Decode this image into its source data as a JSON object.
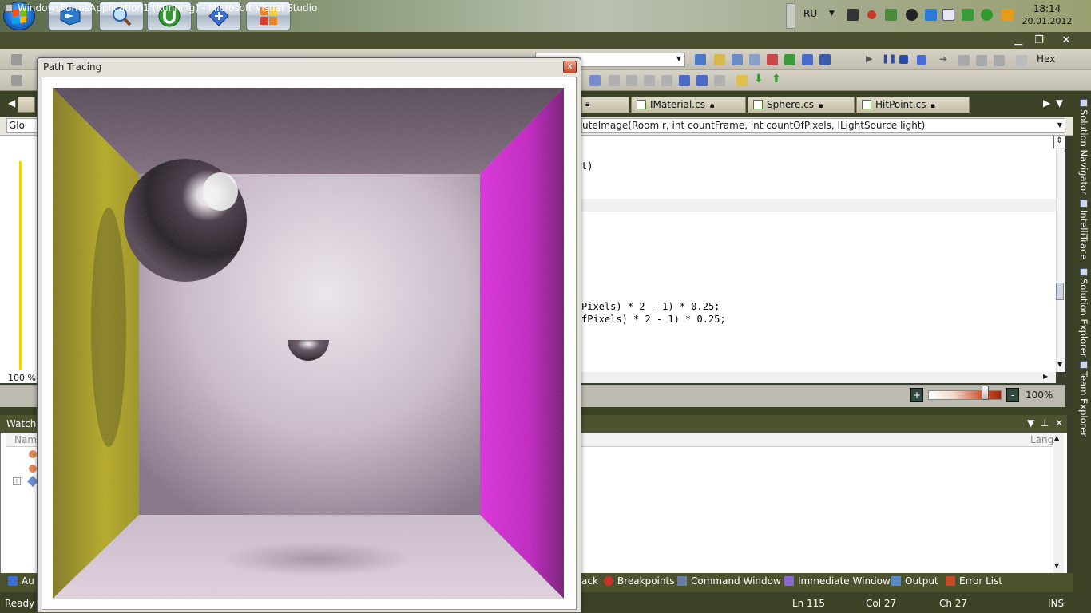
{
  "taskbar": {
    "apps": [
      {
        "name": "vs-app-button",
        "accent": "#2c78c8"
      },
      {
        "name": "search-app-button",
        "accent": "#3a78c8"
      },
      {
        "name": "utorrent-app-button",
        "accent": "#2e9a2e"
      },
      {
        "name": "remote-app-button",
        "accent": "#3a6ed0"
      },
      {
        "name": "office-app-button",
        "accent": "#e4842a"
      }
    ],
    "language": "RU",
    "time": "18:14",
    "date": "20.01.2012"
  },
  "vs": {
    "title": "WindowsFormsApplication1 (Running) - Microsoft Visual Studio",
    "toolbar": {
      "hex_label": "Hex"
    },
    "tabs": [
      {
        "label": "IMaterial.cs"
      },
      {
        "label": "Sphere.cs"
      },
      {
        "label": "HitPoint.cs"
      }
    ],
    "nav": {
      "left_combo": "Glo",
      "method_combo": "uteImage(Room r, int countFrame, int countOfPixels, ILightSource light)"
    },
    "editor": {
      "lines": [
        {
          "text": "t)",
          "row": 0
        },
        {
          "text": "Pixels) * 2 - 1) * 0.25;",
          "row": 1
        },
        {
          "text": "fPixels) * 2 - 1) * 0.25;",
          "row": 2
        }
      ],
      "left_zoom": "100 %",
      "zoom": "100%",
      "zoom_plus": "+",
      "zoom_minus": "-"
    },
    "watch": {
      "title": "Watch",
      "col_name": "Nam",
      "col_lang": "Lang"
    },
    "bottom_tabs": [
      {
        "label": "Au",
        "color": "#3a6ed0"
      },
      {
        "label": "ack",
        "color": "#c84a2a"
      },
      {
        "label": "Breakpoints",
        "color": "#c8342a"
      },
      {
        "label": "Command Window",
        "color": "#6a7fa8"
      },
      {
        "label": "Immediate Window",
        "color": "#8a6ad0"
      },
      {
        "label": "Output",
        "color": "#5a8ac8"
      },
      {
        "label": "Error List",
        "color": "#c84a2a"
      }
    ],
    "status": {
      "ready": "Ready",
      "ln": "Ln 115",
      "col": "Col 27",
      "ch": "Ch 27",
      "ins": "INS"
    },
    "right_dock": [
      "Solution Navigator",
      "IntelliTrace",
      "Solution Explorer",
      "Team Explorer"
    ]
  },
  "path_tracing": {
    "title": "Path Tracing",
    "close": "x",
    "colors": {
      "left_wall": "#b8ab10",
      "right_wall": "#d818d0",
      "back_wall": "#d6c8d6",
      "ceiling": "#6e5a6e",
      "floor": "#d8c8d6"
    }
  }
}
